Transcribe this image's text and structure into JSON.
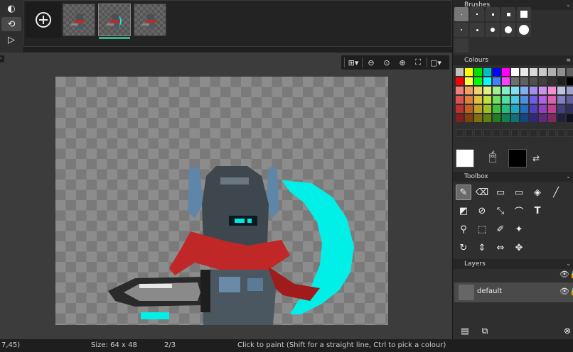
{
  "timeline": {
    "tools": [
      {
        "name": "onion-skin-icon",
        "glyph": "◐"
      },
      {
        "name": "loop-icon",
        "glyph": "⟲"
      },
      {
        "name": "play-icon",
        "glyph": "▷"
      }
    ]
  },
  "view_toolbar": {
    "buttons": [
      "grid-icon",
      "zoom-out-icon",
      "zoom-reset-icon",
      "zoom-in-icon",
      "fit-screen-icon",
      "frame-icon"
    ]
  },
  "canvas": {
    "accent_color": "#00f0e8"
  },
  "status": {
    "coords": "7,45)",
    "size": "Size: 64 x 48",
    "frame": "2/3",
    "hint": "Click to paint (Shift for a straight line, Ctrl to pick a colour)"
  },
  "panels": {
    "brushes": "Brushes",
    "colours": "Colours",
    "toolbox": "Toolbox",
    "layers": "Layers"
  },
  "layers": [
    {
      "name": "default"
    }
  ],
  "palette_rows": [
    [
      "#c0c0c0",
      "#ffff00",
      "#00e000",
      "#00c0c0",
      "#0000ff",
      "#ff00ff",
      "#ffffff",
      "#e8e8e8",
      "#d8d8d8",
      "#c8c8c8",
      "#b0b0b0",
      "#909090",
      "#606060"
    ],
    [
      "#ff0000",
      "#ffff40",
      "#00ff00",
      "#00ffff",
      "#4080ff",
      "#ff40ff",
      "#707070",
      "#606060",
      "#505050",
      "#404040",
      "#303030",
      "#202020",
      "#000000"
    ],
    [
      "#f08080",
      "#f0a060",
      "#f0d070",
      "#e0f080",
      "#a0f090",
      "#80f0c0",
      "#80e0f0",
      "#80b0f0",
      "#a090f0",
      "#d090f0",
      "#f090d0",
      "#c0c0e0",
      "#a0a0d0"
    ],
    [
      "#e05050",
      "#e08040",
      "#e0c040",
      "#c0e040",
      "#70e060",
      "#50e0a0",
      "#50c8e0",
      "#5090e0",
      "#7060e0",
      "#b060e0",
      "#e060b0",
      "#8080c0",
      "#6060a0"
    ],
    [
      "#c03030",
      "#c06020",
      "#c0a020",
      "#a0c020",
      "#40c040",
      "#20c080",
      "#20a8c0",
      "#2070c0",
      "#5040c0",
      "#9040c0",
      "#c04090",
      "#404080",
      "#303060"
    ],
    [
      "#802020",
      "#804010",
      "#807010",
      "#608010",
      "#208020",
      "#108050",
      "#107080",
      "#104880",
      "#302880",
      "#602880",
      "#802860",
      "#202040",
      "#101020"
    ]
  ]
}
